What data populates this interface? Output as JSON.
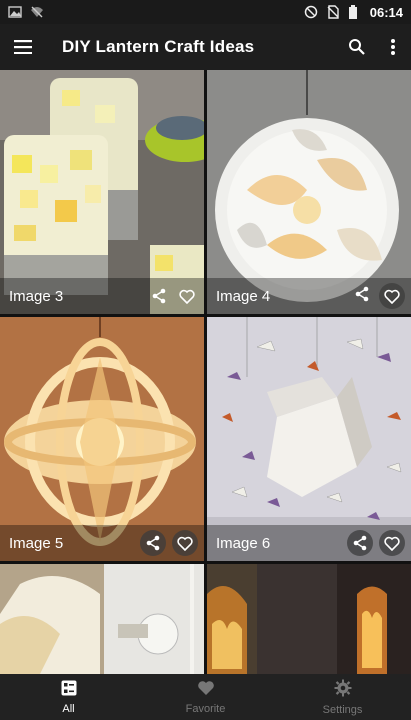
{
  "status_bar": {
    "time": "06:14",
    "left_icons": [
      "image-notification-icon",
      "wifi-off-icon"
    ],
    "right_icons": [
      "do-not-disturb-icon",
      "no-sim-icon",
      "battery-icon"
    ]
  },
  "app_bar": {
    "title": "DIY Lantern Craft Ideas",
    "menu_icon": "hamburger-menu-icon",
    "search_icon": "search-icon",
    "more_icon": "more-vert-icon"
  },
  "grid": {
    "items": [
      {
        "label": "Image 3",
        "share_icon": "share-icon",
        "favorite_icon": "heart-outline-icon"
      },
      {
        "label": "Image 4",
        "share_icon": "share-icon",
        "favorite_icon": "heart-outline-icon"
      },
      {
        "label": "Image 5",
        "share_icon": "share-icon",
        "favorite_icon": "heart-outline-icon"
      },
      {
        "label": "Image 6",
        "share_icon": "share-icon",
        "favorite_icon": "heart-outline-icon"
      },
      {
        "label": "",
        "share_icon": "",
        "favorite_icon": ""
      },
      {
        "label": "",
        "share_icon": "",
        "favorite_icon": ""
      }
    ]
  },
  "bottom_nav": {
    "items": [
      {
        "label": "All",
        "icon": "grid-list-icon",
        "active": true
      },
      {
        "label": "Favorite",
        "icon": "heart-icon",
        "active": false
      },
      {
        "label": "Settings",
        "icon": "gear-icon",
        "active": false
      }
    ]
  },
  "colors": {
    "app_bar": "#1e1e1e",
    "bottom_nav": "#222222",
    "active": "#ffffff",
    "inactive": "#777777"
  }
}
